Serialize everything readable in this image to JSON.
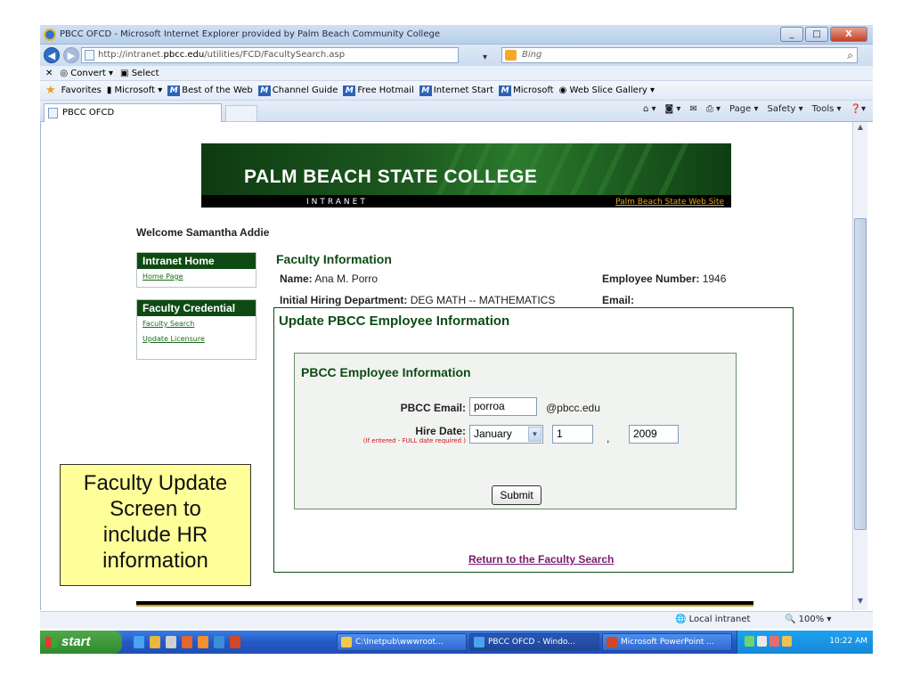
{
  "window": {
    "title": "PBCC OFCD - Microsoft Internet Explorer provided by Palm Beach Community College",
    "min": "_",
    "max": "□",
    "close": "X"
  },
  "address": {
    "prefix": "http://intranet.",
    "domain": "pbcc.edu",
    "path": "/utilities/FCD/FacultySearch.asp",
    "search_placeholder": "Bing"
  },
  "toolbar": {
    "convert": "Convert",
    "select": "Select"
  },
  "favorites": {
    "label": "Favorites",
    "items": [
      "Microsoft",
      "Best of the Web",
      "Channel Guide",
      "Free Hotmail",
      "Internet Start",
      "Microsoft",
      "Web Slice Gallery"
    ]
  },
  "tab": {
    "label": "PBCC OFCD"
  },
  "commands": {
    "page": "Page",
    "safety": "Safety",
    "tools": "Tools"
  },
  "banner": {
    "title": "PALM BEACH STATE COLLEGE",
    "subtitle": "INTRANET",
    "link": "Palm Beach State Web Site"
  },
  "welcome": "Welcome Samantha Addie",
  "sidebar": {
    "intranet_header": "Intranet Home",
    "home_link": "Home Page",
    "faculty_header": "Faculty Credential",
    "search_link": "Faculty Search",
    "license_link": "Update Licensure"
  },
  "faculty": {
    "title": "Faculty Information",
    "name_label": "Name:",
    "name": "Ana M. Porro",
    "emp_label": "Employee Number:",
    "emp_num": "1946",
    "dept_label": "Initial Hiring Department:",
    "dept": "DEG MATH -- MATHEMATICS",
    "email_label": "Email:"
  },
  "form": {
    "panel_title": "Update PBCC Employee Information",
    "inner_title": "PBCC Employee Information",
    "email_label": "PBCC Email:",
    "email_value": "porroa",
    "email_suffix": "@pbcc.edu",
    "hire_label": "Hire Date:",
    "hire_note": "(If entered - FULL date required )",
    "month": "January",
    "day": "1",
    "comma": ",",
    "year": "2009",
    "submit": "Submit",
    "return_link": "Return to the Faculty Search"
  },
  "callout": {
    "lines": [
      "Faculty Update",
      "Screen to",
      "include HR",
      "information"
    ]
  },
  "status": {
    "zone": "Local intranet",
    "zoom": "100%"
  },
  "taskbar": {
    "start": "start",
    "tasks": [
      "C:\\Inetpub\\wwwroot...",
      "PBCC OFCD - Windo...",
      "Microsoft PowerPoint ..."
    ],
    "clock": "10:22 AM"
  },
  "colors": {
    "brand_green": "#0e4b14",
    "accent_gold": "#e3a21c",
    "visited_link": "#7a1b6e"
  }
}
